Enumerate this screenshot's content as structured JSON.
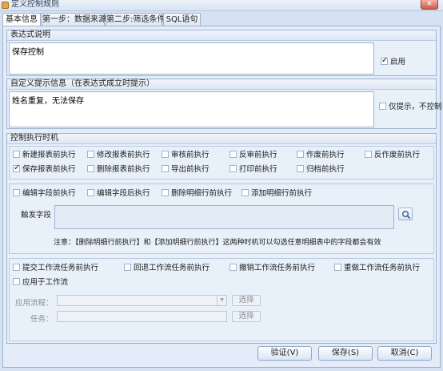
{
  "window": {
    "title": "定义控制规则",
    "close_label": "✕"
  },
  "tabs": [
    "基本信息",
    "第一步：数据来源",
    "第二步:筛选条件",
    "SQL语句"
  ],
  "expression": {
    "group_title": "表达式说明",
    "text": "保存控制",
    "enable_label": "启用",
    "enable_checked": true
  },
  "prompt": {
    "group_title": "自定义提示信息（在表达式成立时提示）",
    "text": "姓名重复，无法保存",
    "prompt_only_label": "仅提示，不控制",
    "prompt_only_checked": false
  },
  "timing": {
    "group_title": "控制执行时机",
    "row1": [
      {
        "label": "新建报表前执行",
        "checked": false
      },
      {
        "label": "修改报表前执行",
        "checked": false
      },
      {
        "label": "审核前执行",
        "checked": false
      },
      {
        "label": "反审前执行",
        "checked": false
      },
      {
        "label": "作废前执行",
        "checked": false
      },
      {
        "label": "反作废前执行",
        "checked": false
      }
    ],
    "row2": [
      {
        "label": "保存报表前执行",
        "checked": true
      },
      {
        "label": "删除报表前执行",
        "checked": false
      },
      {
        "label": "导出前执行",
        "checked": false
      },
      {
        "label": "打印前执行",
        "checked": false
      },
      {
        "label": "归档前执行",
        "checked": false
      }
    ],
    "detail_row": [
      {
        "label": "编辑字段前执行",
        "checked": false
      },
      {
        "label": "编辑字段后执行",
        "checked": false
      },
      {
        "label": "删除明细行前执行",
        "checked": false
      },
      {
        "label": "添加明细行前执行",
        "checked": false
      }
    ],
    "trigger_field_label": "触发字段",
    "note": "注意：【删除明细行前执行】和【添加明细行前执行】这两种时机可以勾选任意明细表中的字段都会有效",
    "workflow_row": [
      {
        "label": "提交工作流任务前执行",
        "checked": false
      },
      {
        "label": "回退工作流任务前执行",
        "checked": false
      },
      {
        "label": "撤销工作流任务前执行",
        "checked": false
      },
      {
        "label": "重做工作流任务前执行",
        "checked": false
      }
    ],
    "apply_workflow_label": "应用于工作流",
    "apply_process_label": "应用流程：",
    "task_label": "任务：",
    "select_label": "选择"
  },
  "footer": {
    "validate_label": "验证(V)",
    "save_label": "保存(S)",
    "cancel_label": "取消(C)"
  }
}
